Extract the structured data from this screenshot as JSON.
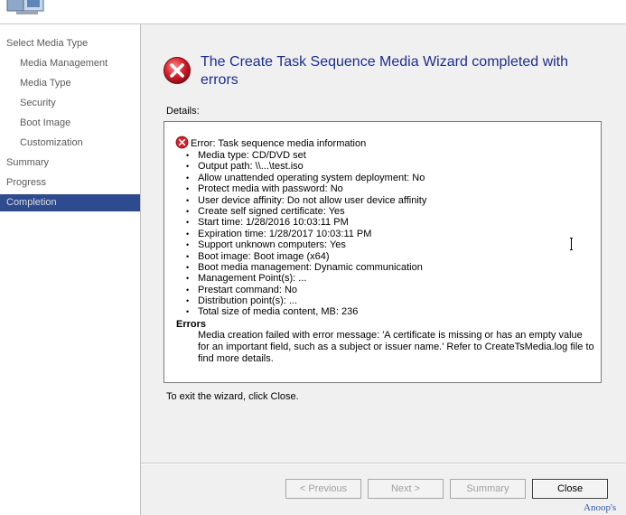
{
  "sidebar": {
    "items": [
      {
        "label": "Select Media Type",
        "level": 0,
        "active": false
      },
      {
        "label": "Media Management",
        "level": 1,
        "active": false
      },
      {
        "label": "Media Type",
        "level": 1,
        "active": false
      },
      {
        "label": "Security",
        "level": 1,
        "active": false
      },
      {
        "label": "Boot Image",
        "level": 1,
        "active": false
      },
      {
        "label": "Customization",
        "level": 1,
        "active": false
      },
      {
        "label": "Summary",
        "level": 0,
        "active": false
      },
      {
        "label": "Progress",
        "level": 0,
        "active": false
      },
      {
        "label": "Completion",
        "level": 0,
        "active": true
      }
    ]
  },
  "main": {
    "title": "The Create Task Sequence Media Wizard completed with errors",
    "details_label": "Details:",
    "error_header": "Error: Task sequence media information",
    "details": [
      "Media type: CD/DVD set",
      "Output path: \\\\...\\test.iso",
      "Allow unattended operating system deployment: No",
      "Protect media with password: No",
      "User device affinity: Do not allow user device affinity",
      "Create self signed certificate: Yes",
      "Start time: 1/28/2016 10:03:11 PM",
      "Expiration time: 1/28/2017 10:03:11 PM",
      "Support unknown computers: Yes",
      "Boot image: Boot image (x64)",
      "Boot media management: Dynamic communication",
      "Management Point(s): ...",
      "Prestart command: No",
      "Distribution point(s): ...",
      "Total size of media content, MB:  236"
    ],
    "errors_heading": "Errors",
    "errors_message": "Media creation failed with error message: 'A certificate is missing or has an empty value for an important field, such as a subject or issuer name.' Refer to CreateTsMedia.log file to find more details.",
    "exit_text": "To exit the wizard, click Close."
  },
  "buttons": {
    "previous": "< Previous",
    "next": "Next >",
    "summary": "Summary",
    "close": "Close"
  },
  "watermark": "Anoop's",
  "colors": {
    "title": "#1e2e8c",
    "active_sidebar": "#2d4b8e",
    "error_icon": "#c8102e"
  }
}
